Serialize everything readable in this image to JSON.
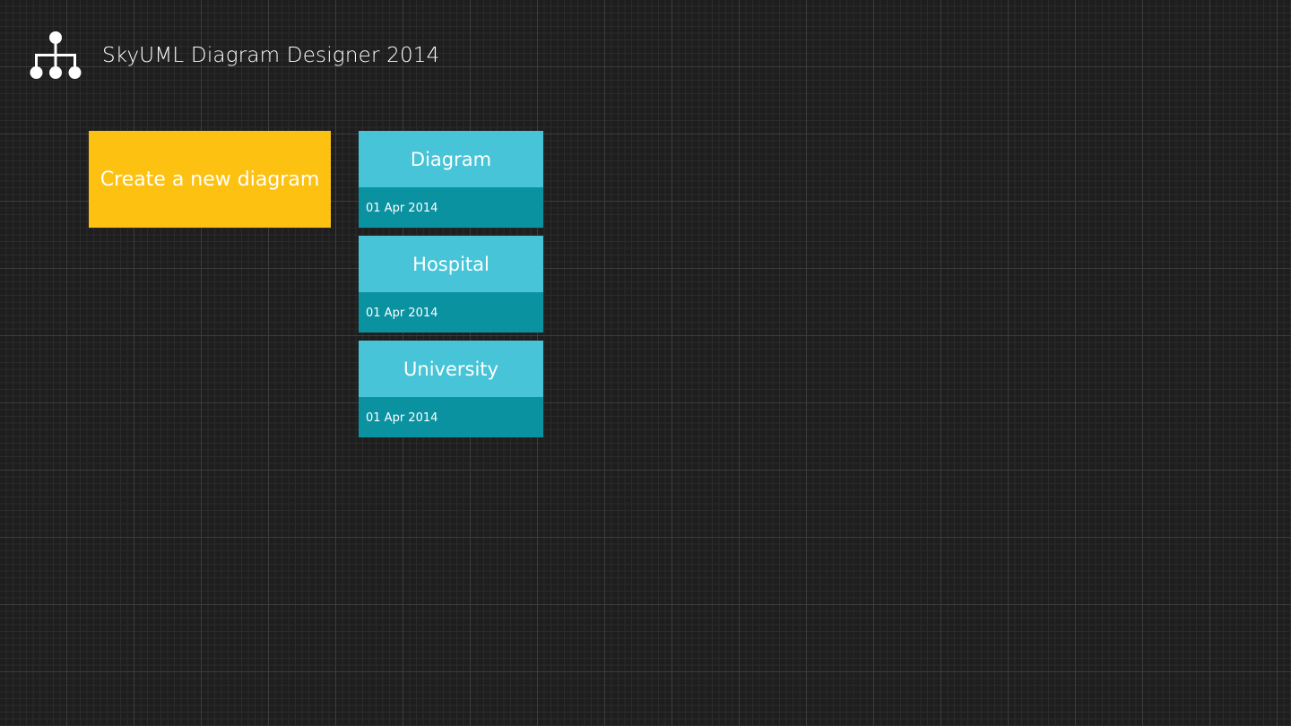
{
  "header": {
    "logo_icon": "hierarchy-diagram-icon",
    "title": "SkyUML Diagram Designer 2014"
  },
  "create_tile": {
    "label": "Create a new diagram",
    "color": "#fdc112"
  },
  "diagrams": [
    {
      "name": "Diagram",
      "date": "01 Apr 2014"
    },
    {
      "name": "Hospital",
      "date": "01 Apr 2014"
    },
    {
      "name": "University",
      "date": "01 Apr 2014"
    }
  ],
  "colors": {
    "background": "#1e1e1e",
    "tile_top": "#47c4d7",
    "tile_bottom": "#0b92a1"
  }
}
